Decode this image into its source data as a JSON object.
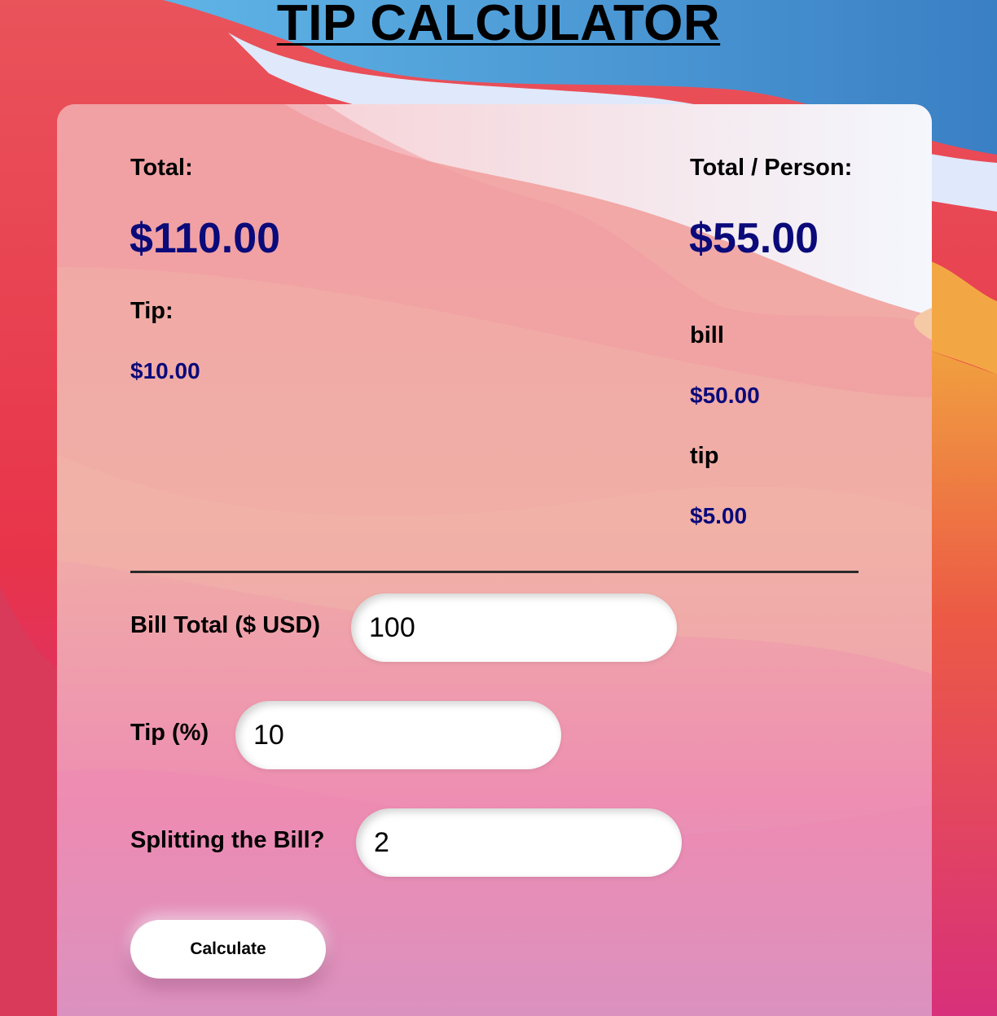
{
  "page": {
    "title": "TIP CALCULATOR"
  },
  "summary": {
    "total_label": "Total:",
    "total_value": "$110.00",
    "tip_label": "Tip:",
    "tip_value": "$10.00",
    "per_person_label": "Total / Person:",
    "per_person_value": "$55.00",
    "bill_label": "bill",
    "bill_value": "$50.00",
    "tip_per_person_label": "tip",
    "tip_per_person_value": "$5.00"
  },
  "form": {
    "bill_label": "Bill Total ($ USD)",
    "bill_value": "100",
    "tip_label": "Tip (%)",
    "tip_value": "10",
    "split_label": "Splitting the Bill?",
    "split_value": "2",
    "calculate_label": "Calculate"
  },
  "colors": {
    "value_color": "#0a0a7a",
    "background_primary": "#e8384f",
    "background_sky": "#4a9ad8"
  }
}
